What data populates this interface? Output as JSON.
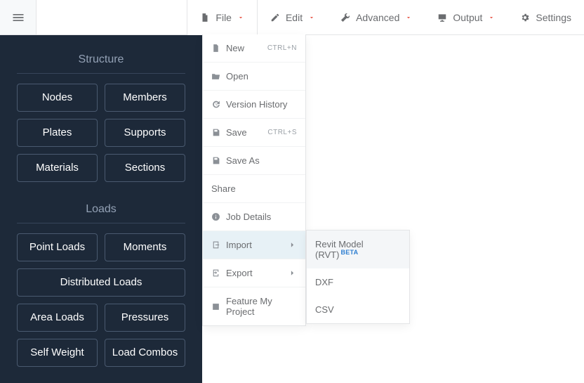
{
  "topnav": {
    "file": "File",
    "edit": "Edit",
    "advanced": "Advanced",
    "output": "Output",
    "settings": "Settings"
  },
  "sidebar": {
    "structure_title": "Structure",
    "structure": [
      "Nodes",
      "Members",
      "Plates",
      "Supports",
      "Materials",
      "Sections"
    ],
    "loads_title": "Loads",
    "loads": [
      "Point Loads",
      "Moments",
      "Distributed Loads",
      "Area Loads",
      "Pressures",
      "Self Weight",
      "Load Combos"
    ]
  },
  "filemenu": {
    "new": "New",
    "new_kbd": "CTRL+N",
    "open": "Open",
    "version_history": "Version History",
    "save": "Save",
    "save_kbd": "CTRL+S",
    "save_as": "Save As",
    "share": "Share",
    "job_details": "Job Details",
    "import": "Import",
    "export": "Export",
    "feature": "Feature My Project"
  },
  "import_submenu": {
    "revit": "Revit Model (RVT)",
    "revit_badge": "BETA",
    "dxf": "DXF",
    "csv": "CSV"
  }
}
